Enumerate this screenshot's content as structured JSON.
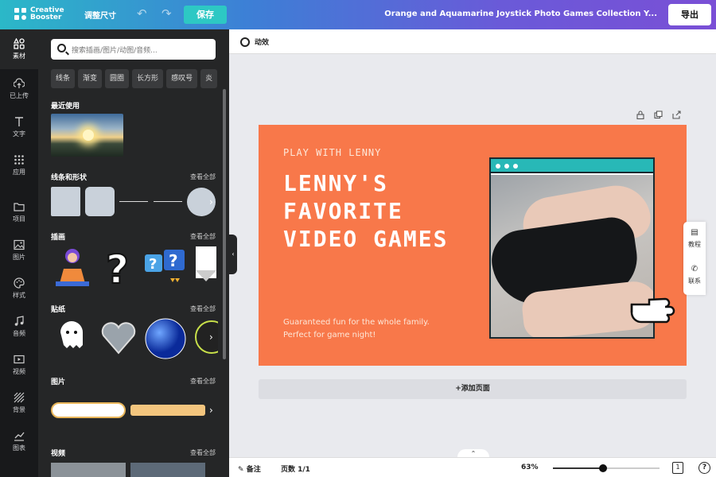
{
  "topbar": {
    "brand_line1": "Creative",
    "brand_line2": "Booster",
    "resize_label": "调整尺寸",
    "save_label": "保存",
    "doc_title": "Orange and Aquamarine Joystick Photo Games Collection Y...",
    "export_label": "导出"
  },
  "rail": [
    {
      "label": "素材",
      "icon": "elements-icon"
    },
    {
      "label": "已上传",
      "icon": "upload-icon"
    },
    {
      "label": "文字",
      "icon": "text-icon"
    },
    {
      "label": "应用",
      "icon": "apps-icon"
    },
    {
      "label": "项目",
      "icon": "folder-icon"
    },
    {
      "label": "图片",
      "icon": "image-icon"
    },
    {
      "label": "样式",
      "icon": "palette-icon"
    },
    {
      "label": "音频",
      "icon": "music-icon"
    },
    {
      "label": "视频",
      "icon": "video-icon"
    },
    {
      "label": "背景",
      "icon": "background-icon"
    },
    {
      "label": "图表",
      "icon": "chart-icon"
    }
  ],
  "panel": {
    "search_placeholder": "搜索插画/图片/动图/音频...",
    "chips": [
      "线条",
      "渐变",
      "圆圈",
      "长方形",
      "感叹号",
      "炎"
    ],
    "recent_title": "最近使用",
    "see_all": "查看全部",
    "lines_title": "线条和形状",
    "illus_title": "插画",
    "sticker_title": "贴纸",
    "photo_title": "图片",
    "video_title": "视频"
  },
  "editor": {
    "animate_label": "动效",
    "add_page_label": "+添加页面"
  },
  "canvas": {
    "subtitle": "PLAY WITH LENNY",
    "title": "LENNY'S\nFAVORITE\nVIDEO GAMES",
    "body": "Guaranteed fun for the whole family.\nPerfect for game night!",
    "background_color": "#f8784a",
    "accent_color": "#28b8b7"
  },
  "side_help": {
    "tutorial_label": "教程",
    "contact_label": "联系"
  },
  "bottom": {
    "notes_label": "备注",
    "pages_label": "页数 1/1",
    "zoom_label": "63%",
    "zoom_level": 0.47,
    "page_count": "1",
    "help_label": "?"
  }
}
